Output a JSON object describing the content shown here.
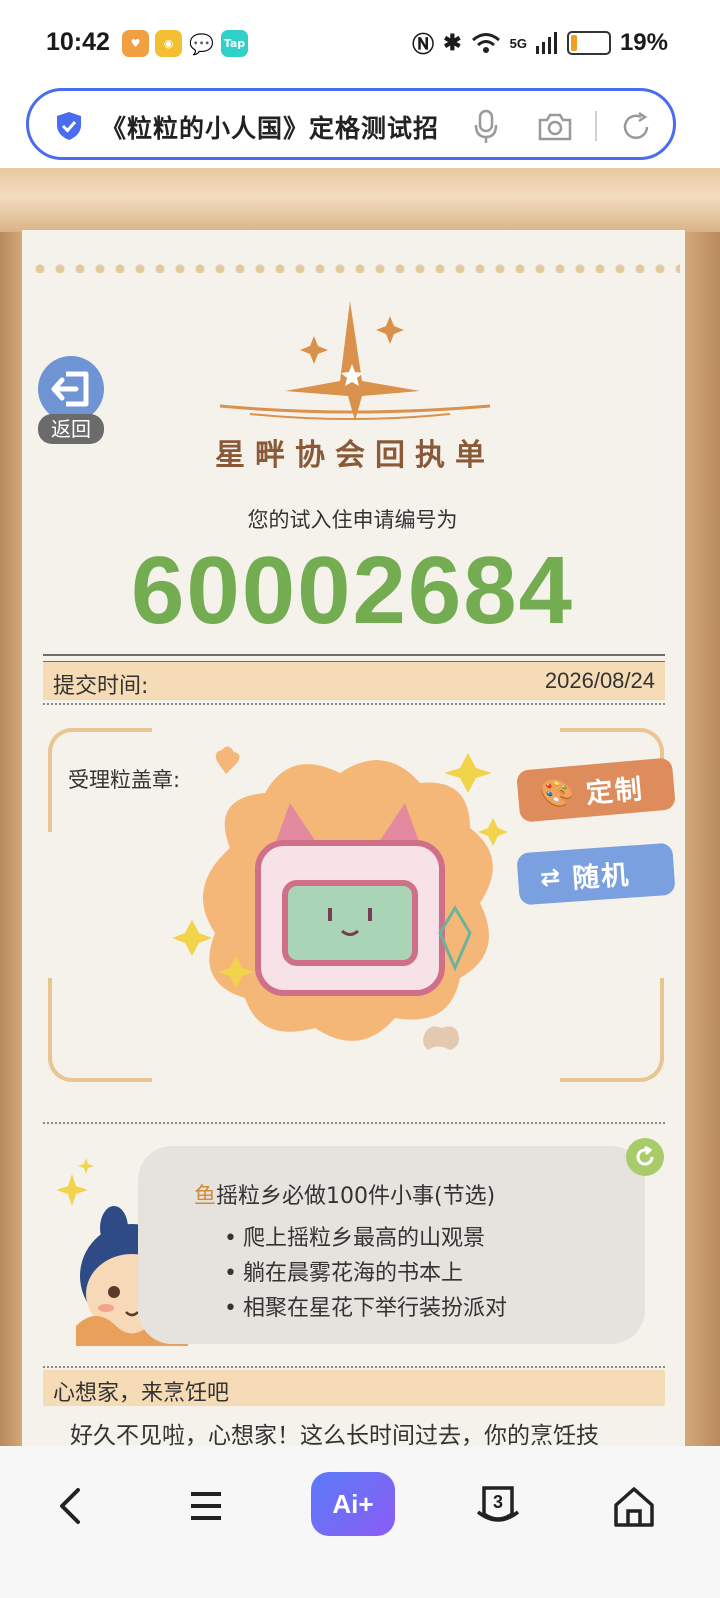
{
  "status_bar": {
    "time": "10:42",
    "network": "5G",
    "battery": "19%",
    "battery_level": 0.19
  },
  "search_bar": {
    "query": "《粒粒的小人国》定格测试招"
  },
  "page": {
    "back_label": "返回",
    "logo_title": "星畔协会回执单",
    "application_label": "您的试入住申请编号为",
    "application_number": "60002684",
    "submit_label": "提交时间:",
    "submit_date": "2026/08/24",
    "stamp_label": "受理粒盖章:",
    "custom_button": "定制",
    "random_button": "随机",
    "todo_card": {
      "highlight": "鱼",
      "title": "摇粒乡必做100件小事(节选)",
      "items": [
        "爬上摇粒乡最高的山观景",
        "躺在晨雾花海的书本上",
        "相聚在星花下举行装扮派对"
      ]
    },
    "section_title": "心想家，来烹饪吧",
    "intro_text": "好久不见啦，心想家！这么长时间过去，你的烹饪技"
  },
  "nav": {
    "ai_label": "Ai+",
    "tab_count": "3"
  },
  "colors": {
    "accent_blue": "#4a6cf0",
    "number_green": "#74ac52",
    "band_beige": "#f6dcb6",
    "custom_orange": "#df8c5c",
    "random_blue": "#7aa0e0"
  }
}
